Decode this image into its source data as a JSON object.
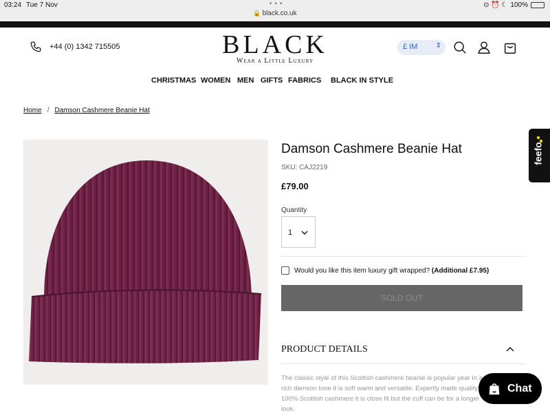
{
  "status_bar": {
    "time": "03:24",
    "date": "Tue 7 Nov",
    "url": "black.co.uk",
    "battery": "100%",
    "battery_level": 0.7,
    "battery_color": "#3cc43c"
  },
  "header": {
    "phone": "+44 (0) 1342 715505",
    "logo": "BLACK",
    "tagline": "Wear a Little Luxury",
    "currency": "£ IM"
  },
  "nav": {
    "items": [
      "CHRISTMAS",
      "WOMEN",
      "MEN",
      "GIFTS",
      "FABRICS",
      "BLACK IN STYLE"
    ]
  },
  "breadcrumb": {
    "home": "Home",
    "separator": "/",
    "current": "Damson Cashmere Beanie Hat"
  },
  "product": {
    "title": "Damson Cashmere Beanie Hat",
    "sku": "SKU: CAJ2219",
    "price": "£79.00",
    "image_color": "#6b2042",
    "quantity_label": "Quantity",
    "quantity_value": "1",
    "gift_text": "Would you like this item luxury gift wrapped?",
    "gift_extra": "(Additional £7.95)",
    "sold_out_label": "SOLD OUT",
    "details_heading": "PRODUCT DETAILS",
    "description": "The classic style of this Scottish cashmere beanie is popular year In a rich damson tone it is soft warm and versatile. Expertly made quality 100% Scottish cashmere it is close fit but the cuff can be for a longer look."
  },
  "feefo": {
    "label": "feefo"
  },
  "chat": {
    "label": "Chat"
  }
}
